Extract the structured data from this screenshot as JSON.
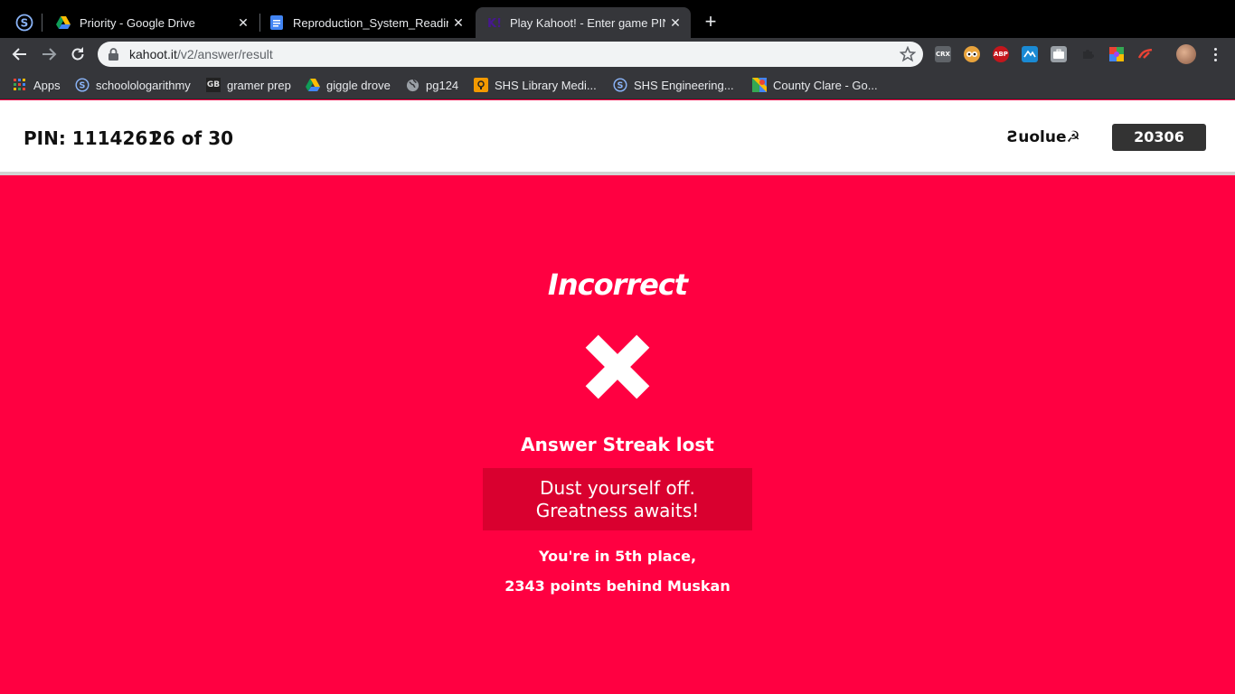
{
  "browser": {
    "tabs": [
      {
        "title": "Priority - Google Drive",
        "icon": "google-drive-icon",
        "close": "✕"
      },
      {
        "title": "Reproduction_System_Reading",
        "icon": "google-docs-icon",
        "close": "✕"
      },
      {
        "title": "Play Kahoot! - Enter game PIN",
        "icon": "kahoot-icon",
        "close": "✕",
        "active": true
      }
    ],
    "new_tab": "+",
    "url_host": "kahoot.it",
    "url_path": "/v2/answer/result",
    "extensions": [
      {
        "name": "crx-icon",
        "label": "CRX",
        "color": "#5f6368"
      },
      {
        "name": "owl-icon",
        "label": "",
        "color": "#e8a33c"
      },
      {
        "name": "adblock-icon",
        "label": "ABP",
        "color": "#c4161c"
      },
      {
        "name": "cast-icon",
        "label": "",
        "color": "#1a8ad4"
      },
      {
        "name": "briefcase-icon",
        "label": "",
        "color": "#9aa0a6"
      },
      {
        "name": "puzzle-icon",
        "label": "",
        "color": "#35363a"
      },
      {
        "name": "color-wheel-icon",
        "label": "",
        "color": "#a142f4"
      },
      {
        "name": "pen-icon",
        "label": "",
        "color": "#35363a"
      }
    ]
  },
  "bookmarks": [
    {
      "label": "Apps",
      "icon": "apps-grid-icon"
    },
    {
      "label": "schoolologarithmy",
      "icon": "schoology-icon"
    },
    {
      "label": "gramer prep",
      "icon": "gb-icon"
    },
    {
      "label": "giggle drove",
      "icon": "google-drive-icon"
    },
    {
      "label": "pg124",
      "icon": "globe-icon"
    },
    {
      "label": "SHS Library Medi...",
      "icon": "library-icon"
    },
    {
      "label": "SHS Engineering...",
      "icon": "schoology-icon"
    },
    {
      "label": "County Clare - Go...",
      "icon": "google-maps-icon"
    }
  ],
  "header": {
    "pin": "PIN: 1114261",
    "question_count": "26 of 30",
    "nickname": "Ƨuolue☭",
    "score": "20306"
  },
  "result": {
    "status": "Incorrect",
    "streak": "Answer Streak lost",
    "message": "Dust yourself off. Greatness awaits!",
    "place": "You're in 5th place,",
    "behind": "2343 points behind Muskan",
    "background_color": "#ff0041",
    "message_bg_color": "#d9002f"
  }
}
